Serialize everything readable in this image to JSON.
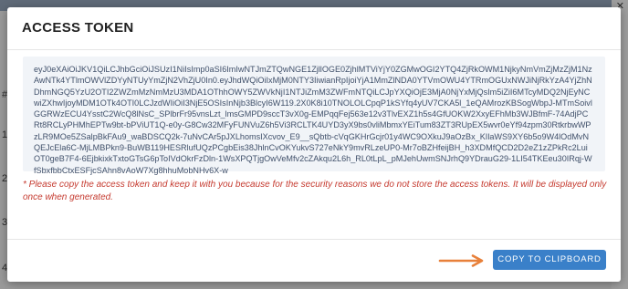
{
  "background": {
    "rows": [
      "#",
      "1",
      "2",
      "3",
      "4"
    ]
  },
  "modal": {
    "title": "ACCESS TOKEN",
    "token": "eyJ0eXAiOiJKV1QiLCJhbGciOiJSUzI1NiIsImp0aSI6ImIwNTJmZTQwNGE1ZjllOGE0ZjhlMTViYjY0ZGMwOGI2YTQ4ZjRkOWM1NjkyNmVmZjMzZjM1NzAwNTk4YTlmOWVlZDYyNTUyYmZjN2VhZjU0In0.eyJhdWQiOiIxMjM0NTY3IiwianRpIjoiYjA1MmZlNDA0YTVmOWU4YTRmOGUxNWJiNjRkYzA4YjZhNDhmNGQ5YzU2OTI2ZWZmMzNmMzU3MDA1OThhOWY5ZWVkNjI1NTJiZmM3ZWFmNTQiLCJpYXQiOjE3MjA0NjYxMjQsIm5iZiI6MTcyMDQ2NjEyNCwiZXhwIjoyMDM1OTk4OTI0LCJzdWIiOiI3NjE5OSIsInNjb3BlcyI6W119.2X0K8i10TNOLOLCpqP1kSYfq4yUV7CKA5l_1eQAMrozKBSogWbpJ-MTmSoivlGGRWzECU4YsstC2WcQ8lNsC_SPlbrFr95vnsLzt_lmsGMPD9sccT3vX0g-EMPqqFej563e12v3TlvEXZ1h5s4GfUOKW2XxyEFhMb3WJBfmF-74AdjPCRt8RCLyPHMhEPTw9bt-bPViUT1Q-e0y-G8Cw32MFyFUNVuZ6h5Vi3RCLTK4UYD3yX9bs0vliMbmxYEiTum83ZT3RUpEX5wvr0eYf94zpm30RtkrbwWPzLR9MOe5ZSalpBkFAu9_waBDSCQ2k-7uNvCAr5pJXLhomsIXcvov_E9__sQbtb-cVqGKHrGcjr01y4WC9OXkuJ9aOzBx_KIlaWS9XY6b5o9W4lOdMvNQEJcEla6C-MjLMBPkn9-BuWB119HESRlufUQzPCgbEis38JhlnCvOKYukvS727eNkY9mvRLzeUP0-Mr7oBZHfeijBH_h3XDMfQCD2D2eZ1zZPkRc2LuiOT0geB7F4-6EjbkixkTxtoGTsG6pToIVdOkrFzDln-1WsXPQTjgOwVeMfv2cZAkqu2L6h_RL0tLpL_pMJehUwmSNJrhQ9YDrauG29-1LI54TKEeu30IRqj-WfSbxfbbCtxESFjcSAhn8vAoW7Xg8hhuMobNHv6X-w",
    "notice": "* Please copy the access token and keep it with you because for the security reasons we do not store the access tokens. It will be displayed only once when generated.",
    "copy_button_label": "COPY TO CLIPBOARD"
  },
  "colors": {
    "button": "#3a80c9",
    "notice": "#c53a2f",
    "arrow": "#e8803a",
    "token_box": "#f1f4f8"
  },
  "icons": [
    "arrow-right-icon",
    "close-icon"
  ]
}
